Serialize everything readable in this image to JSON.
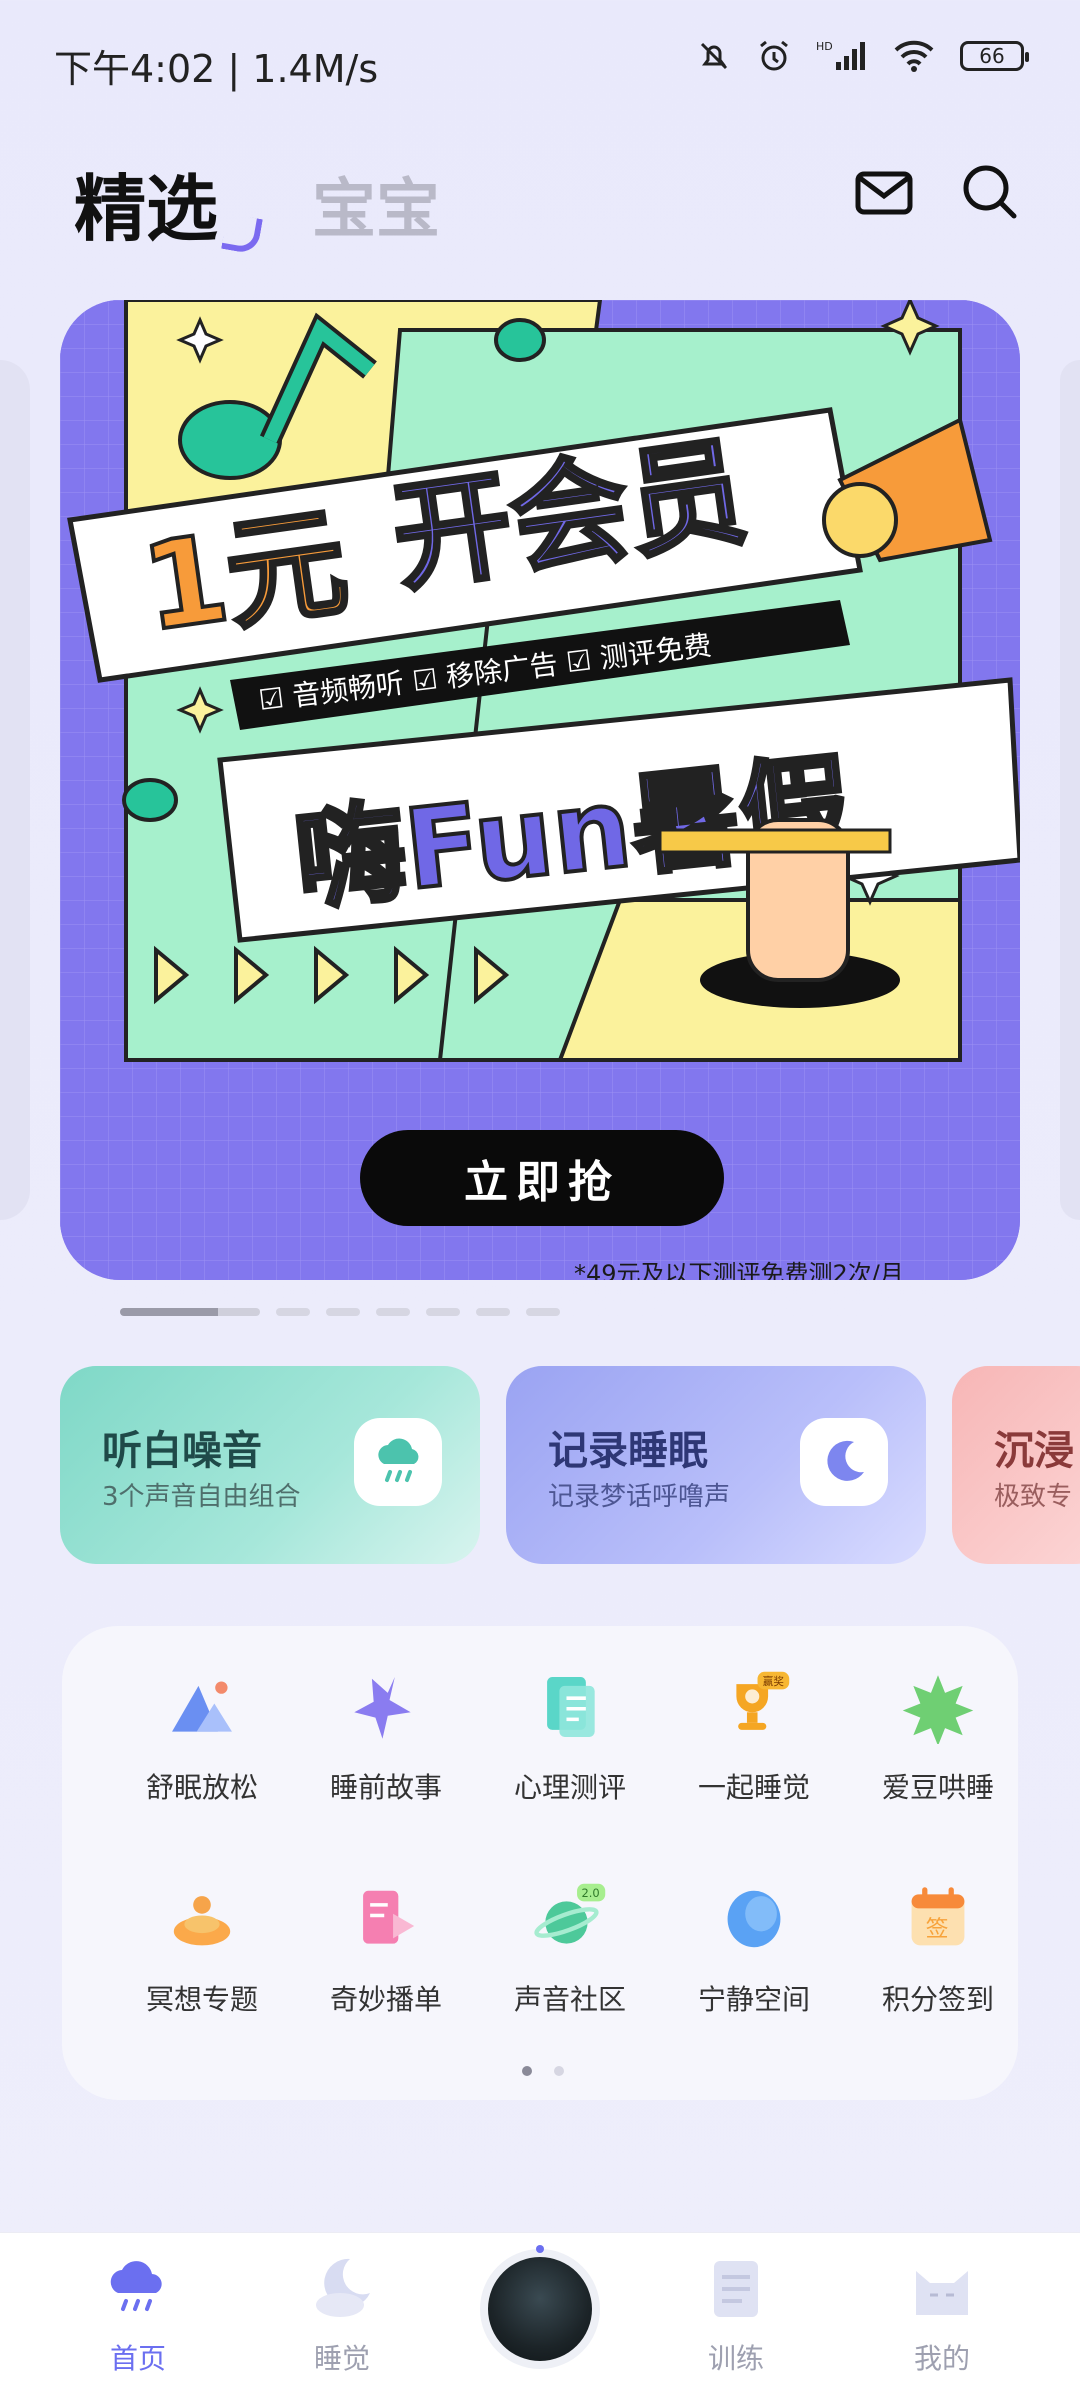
{
  "status": {
    "time_speed": "下午4:02 | 1.4M/s",
    "battery": "66",
    "icons": [
      "mute-bell-icon",
      "alarm-icon",
      "hd-signal-icon",
      "wifi-icon",
      "battery-icon"
    ]
  },
  "header": {
    "tabs": [
      {
        "label": "精选",
        "active": true
      },
      {
        "label": "宝宝",
        "active": false
      }
    ],
    "icons": [
      "mail-icon",
      "search-icon"
    ]
  },
  "banner": {
    "headline": "1元开会员",
    "subline": "嗨Fun暑假",
    "features": [
      "音频畅听",
      "移除广告",
      "测评免费"
    ],
    "cta": "立即抢",
    "footnote": "*49元及以下测评免费测2次/月",
    "pages": 8,
    "current_page": 1,
    "colors": {
      "bg": "#8a7ef0",
      "yellow": "#fbf3a0",
      "mint": "#9df0c8",
      "orange": "#f79b3a",
      "purple": "#7068e6"
    }
  },
  "cards": [
    {
      "title": "听白噪音",
      "subtitle": "3个声音自由组合",
      "icon": "rain-cloud-icon"
    },
    {
      "title": "记录睡眠",
      "subtitle": "记录梦话呼噜声",
      "icon": "moon-icon"
    },
    {
      "title": "沉浸",
      "subtitle": "极致专",
      "icon": ""
    }
  ],
  "grid": {
    "items": [
      {
        "label": "舒眠放松",
        "icon": "mountain-icon"
      },
      {
        "label": "睡前故事",
        "icon": "star-icon"
      },
      {
        "label": "心理测评",
        "icon": "document-icon"
      },
      {
        "label": "一起睡觉",
        "icon": "trophy-icon",
        "badge": "赢奖"
      },
      {
        "label": "爱豆哄睡",
        "icon": "burst-star-icon"
      },
      {
        "label": "冥想专题",
        "icon": "meditation-icon"
      },
      {
        "label": "奇妙播单",
        "icon": "playlist-icon"
      },
      {
        "label": "声音社区",
        "icon": "planet-icon",
        "badge": "2.0"
      },
      {
        "label": "宁静空间",
        "icon": "orb-icon"
      },
      {
        "label": "积分签到",
        "icon": "calendar-sign-icon",
        "badge": "签"
      }
    ],
    "pages": 2,
    "current_page": 1
  },
  "bottom_nav": {
    "items": [
      {
        "label": "首页",
        "icon": "cloud-rain-icon",
        "active": true
      },
      {
        "label": "睡觉",
        "icon": "moon-cloud-icon",
        "active": false
      },
      {
        "label": "",
        "icon": "now-playing-thumbnail",
        "active": false
      },
      {
        "label": "训练",
        "icon": "notepad-icon",
        "active": false
      },
      {
        "label": "我的",
        "icon": "cat-face-icon",
        "active": false
      }
    ]
  }
}
